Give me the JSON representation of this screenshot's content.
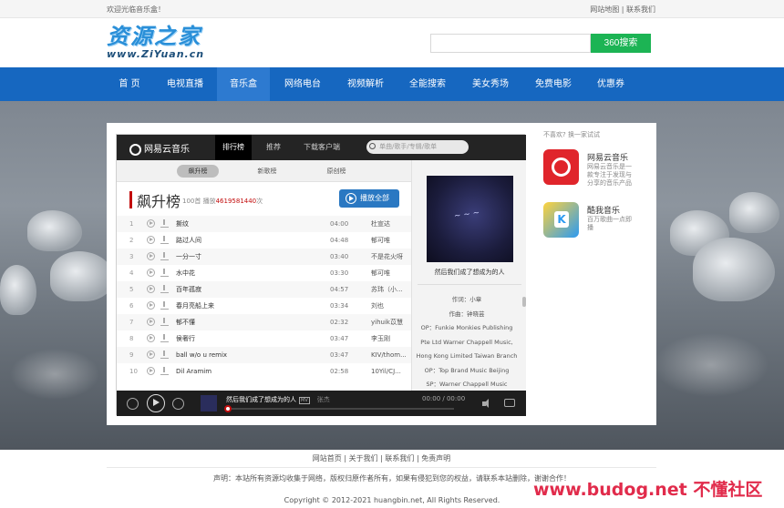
{
  "topbar": {
    "welcome": "欢迎光临音乐盒！",
    "links": [
      "网站地图",
      "联系我们"
    ],
    "sep": "|"
  },
  "header": {
    "logo_cn": "资源之家",
    "logo_en": "www.ZiYuan.cn",
    "search_placeholder": "",
    "search_button": "360搜索"
  },
  "nav": [
    {
      "label": "首 页",
      "active": false
    },
    {
      "label": "电视直播",
      "active": false
    },
    {
      "label": "音乐盒",
      "active": true
    },
    {
      "label": "网络电台",
      "active": false
    },
    {
      "label": "视频解析",
      "active": false
    },
    {
      "label": "全能搜索",
      "active": false
    },
    {
      "label": "美女秀场",
      "active": false
    },
    {
      "label": "免费电影",
      "active": false
    },
    {
      "label": "优惠券",
      "active": false
    }
  ],
  "player": {
    "brand": "网易云音乐",
    "tabs": [
      "排行榜",
      "推荐",
      "下载客户端"
    ],
    "search_placeholder": "单曲/歌手/专辑/歌单",
    "subtabs": [
      "飙升榜",
      "新歌榜",
      "原创榜"
    ],
    "list_title": "飙升榜",
    "list_meta_prefix": "100首 播放",
    "list_meta_count": "4619581440",
    "list_meta_suffix": "次",
    "play_all": "播放全部",
    "songs": [
      {
        "n": "1",
        "name": "撕纹",
        "dur": "04:00",
        "artist": "杜宣达"
      },
      {
        "n": "2",
        "name": "路过人间",
        "dur": "04:48",
        "artist": "郁可唯"
      },
      {
        "n": "3",
        "name": "一分一寸",
        "dur": "03:40",
        "artist": "不是花火呀"
      },
      {
        "n": "4",
        "name": "水中花",
        "dur": "03:30",
        "artist": "郁可唯"
      },
      {
        "n": "5",
        "name": "百年孤寂",
        "dur": "04:57",
        "artist": "苏玮（小..."
      },
      {
        "n": "6",
        "name": "春月亮船上来",
        "dur": "03:34",
        "artist": "刘也"
      },
      {
        "n": "7",
        "name": "郁不懂",
        "dur": "02:32",
        "artist": "yihuik苡慧"
      },
      {
        "n": "8",
        "name": "侯奢行",
        "dur": "03:47",
        "artist": "李玉刚"
      },
      {
        "n": "9",
        "name": "ball w/o u remix",
        "dur": "03:47",
        "artist": "KIV/thom..."
      },
      {
        "n": "10",
        "name": "Dil Aramim",
        "dur": "02:58",
        "artist": "10Yil/CJ..."
      }
    ],
    "current_title": "然后我们成了想成为的人",
    "lyrics": [
      "作词：小章",
      "作曲：钟晓芸",
      "OP：Funkie Monkies Publishing",
      "Pte Ltd Warner Chappell Music,",
      "Hong Kong Limited Taiwan Branch",
      "OP：Top Brand Music Beijing",
      "SP：Warner Chappell Music"
    ],
    "footer": {
      "title": "然后我们成了想成为的人",
      "mv": "MV",
      "artist": "张杰",
      "time": "00:00 / 00:00"
    }
  },
  "side": {
    "hint": "不喜欢? 换一家试试",
    "apps": [
      {
        "name": "网易云音乐",
        "desc": "网易云音乐是一款专注于发现与分享的音乐产品",
        "color": "#e0252b"
      },
      {
        "name": "酷我音乐",
        "desc": "百万歌曲一点即播",
        "color": "#2c9af1"
      }
    ]
  },
  "footer": {
    "links": [
      "网站首页",
      "关于我们",
      "联系我们",
      "免责声明"
    ],
    "sep": "|",
    "disclaimer": "声明：本站所有资源均收集于网络，版权归原作者所有，如果有侵犯到您的权益，请联系本站删除，谢谢合作！",
    "copyright": "Copyright © 2012-2021 huangbin.net, All Rights Reserved.",
    "watermark": "www.budog.net 不懂社区"
  }
}
